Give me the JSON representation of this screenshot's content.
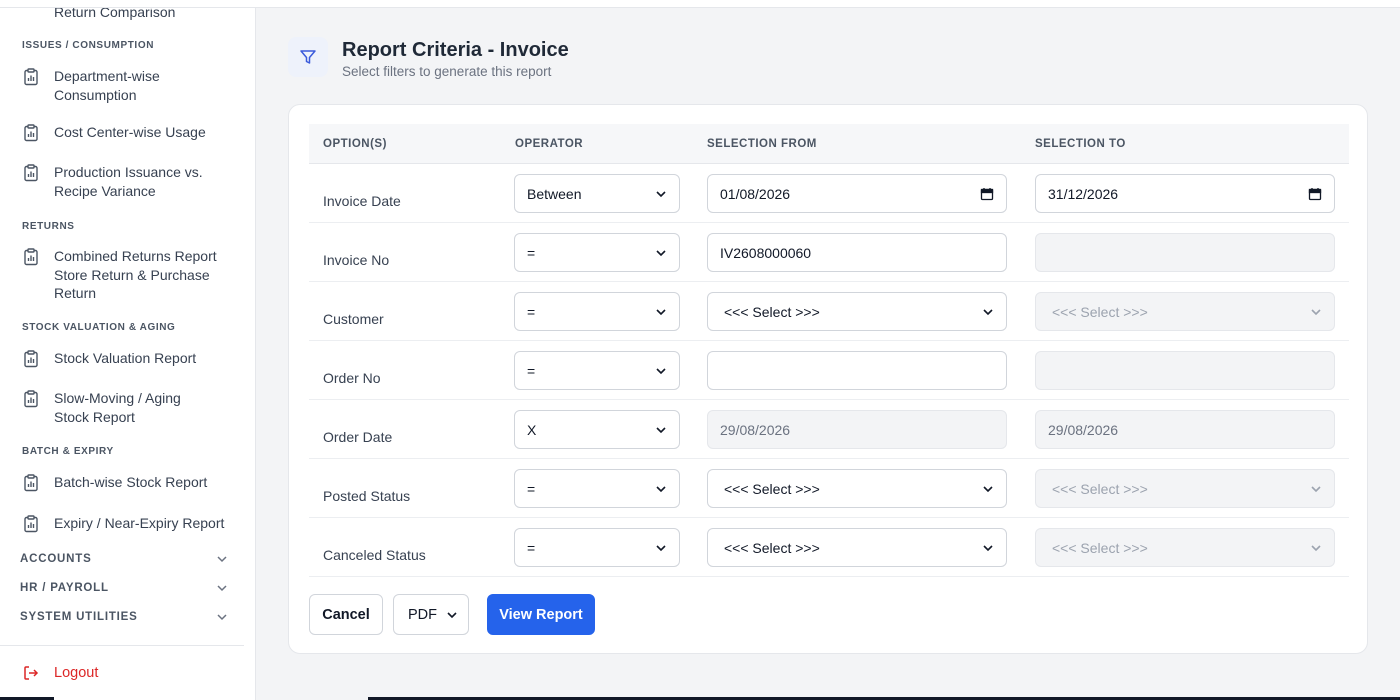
{
  "sidebar": {
    "cut_item": "Return Comparison",
    "sections": {
      "issues": "ISSUES / CONSUMPTION",
      "returns": "RETURNS",
      "stock_valuation": "STOCK VALUATION & AGING",
      "batch": "BATCH & EXPIRY"
    },
    "items": [
      "Department-wise\nConsumption",
      "Cost Center-wise Usage",
      "Production Issuance vs.\nRecipe Variance",
      "Combined Returns Report\nStore Return & Purchase\nReturn",
      "Stock Valuation Report",
      "Slow-Moving / Aging\nStock Report",
      "Batch-wise Stock Report",
      "Expiry / Near-Expiry Report"
    ],
    "groups": [
      "ACCOUNTS",
      "HR / PAYROLL",
      "SYSTEM UTILITIES"
    ],
    "logout": "Logout"
  },
  "header": {
    "title": "Report Criteria - Invoice",
    "subtitle": "Select filters to generate this report"
  },
  "table": {
    "columns": [
      "OPTION(S)",
      "OPERATOR",
      "SELECTION FROM",
      "SELECTION TO"
    ],
    "rows": [
      {
        "option": "Invoice Date",
        "operator": "Between",
        "from": "01/08/2026",
        "to": "31/12/2026"
      },
      {
        "option": "Invoice No",
        "operator": "=",
        "from": "IV2608000060",
        "to": ""
      },
      {
        "option": "Customer",
        "operator": "=",
        "from": "<<< Select >>>",
        "to": "<<< Select >>>"
      },
      {
        "option": "Order No",
        "operator": "=",
        "from": "",
        "to": ""
      },
      {
        "option": "Order Date",
        "operator": "X",
        "from": "29/08/2026",
        "to": "29/08/2026"
      },
      {
        "option": "Posted Status",
        "operator": "=",
        "from": "<<< Select >>>",
        "to": "<<< Select >>>"
      },
      {
        "option": "Canceled Status",
        "operator": "=",
        "from": "<<< Select >>>",
        "to": "<<< Select >>>"
      }
    ]
  },
  "actions": {
    "cancel": "Cancel",
    "format": "PDF",
    "view": "View Report"
  },
  "colors": {
    "primary": "#2563eb",
    "logout": "#dc2626",
    "background": "#f3f4f6"
  }
}
